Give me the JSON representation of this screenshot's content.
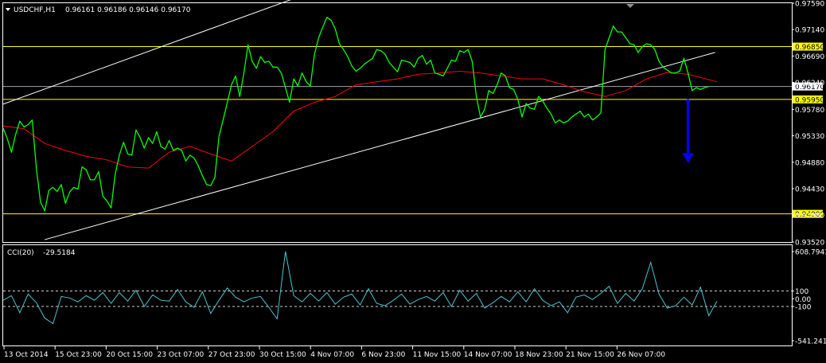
{
  "chart_data": [
    {
      "type": "line",
      "instrument": "USDCHF,H1",
      "header_values": "0.96161 0.96186 0.96146 0.96170",
      "ylim": [
        0.9352,
        0.9759
      ],
      "y_ticks": [
        "0.97590",
        "0.97140",
        "0.96690",
        "0.96240",
        "0.95780",
        "0.95330",
        "0.94880",
        "0.94430",
        "0.93980",
        "0.93520"
      ],
      "x_ticks": [
        "13 Oct 2014",
        "15 Oct 23:00",
        "20 Oct 15:00",
        "23 Oct 07:00",
        "27 Oct 23:00",
        "30 Oct 15:00",
        "4 Nov 07:00",
        "6 Nov 23:00",
        "11 Nov 15:00",
        "14 Nov 07:00",
        "18 Nov 23:00",
        "21 Nov 15:00",
        "26 Nov 07:00"
      ],
      "horizontal_levels": [
        {
          "value": 0.9685,
          "label": "0.96850",
          "color": "#ffff00"
        },
        {
          "value": 0.9595,
          "label": "0.95950",
          "color": "#ffff00"
        },
        {
          "value": 0.94,
          "label": "0.94000",
          "color": "#ffff00"
        },
        {
          "value": 0.9617,
          "label": "0.96170",
          "color": "#9aa3b5",
          "kind": "bid"
        }
      ],
      "channel_lines": [
        {
          "color": "#ffffff",
          "points": [
            [
              0,
              0.9587
            ],
            [
              176,
              0.9813
            ]
          ]
        },
        {
          "color": "#ffffff",
          "points": [
            [
              20,
              0.9356
            ],
            [
              343,
              0.9675
            ]
          ]
        }
      ],
      "price_series": {
        "name": "price",
        "color": "#00ff00",
        "x": [
          0,
          2,
          4,
          6,
          8,
          10,
          12,
          14,
          16,
          18,
          20,
          22,
          24,
          26,
          28,
          30,
          32,
          34,
          36,
          38,
          40,
          42,
          44,
          46,
          48,
          50,
          52,
          54,
          56,
          58,
          60,
          62,
          64,
          66,
          68,
          70,
          72,
          74,
          76,
          78,
          80,
          82,
          84,
          86,
          88,
          90,
          92,
          94,
          96,
          98,
          100,
          102,
          104,
          106,
          108,
          110,
          112,
          114,
          116,
          118,
          120,
          122,
          124,
          126,
          128,
          130,
          132,
          134,
          136,
          138,
          140,
          142,
          144,
          146,
          148,
          150,
          152,
          154,
          156,
          158,
          160,
          162,
          164,
          166,
          168,
          170,
          172,
          174,
          176,
          178,
          180,
          182,
          184,
          186,
          188,
          190,
          192,
          194,
          196,
          198,
          200,
          202,
          204,
          206,
          208,
          210,
          212,
          214,
          216,
          218,
          220,
          222,
          224,
          226,
          228,
          230,
          232,
          234,
          236,
          238,
          240,
          242,
          244,
          246,
          248,
          250,
          252,
          254,
          256,
          258,
          260,
          262,
          264,
          266,
          268,
          270,
          272,
          274,
          276,
          278,
          280,
          282,
          284,
          286,
          288,
          290,
          292,
          294,
          296,
          298,
          300,
          302,
          304,
          306,
          308,
          310,
          312,
          314,
          316,
          318,
          320,
          322,
          324,
          326,
          328,
          330,
          332,
          334,
          336,
          338,
          340,
          342,
          344
        ],
        "values": [
          0.9546,
          0.9528,
          0.9505,
          0.9535,
          0.9558,
          0.9548,
          0.9552,
          0.956,
          0.9478,
          0.942,
          0.9405,
          0.944,
          0.9445,
          0.9438,
          0.945,
          0.9418,
          0.9437,
          0.9445,
          0.9442,
          0.948,
          0.9475,
          0.9458,
          0.9458,
          0.9472,
          0.943,
          0.9422,
          0.941,
          0.9468,
          0.95,
          0.9522,
          0.9502,
          0.95,
          0.9543,
          0.953,
          0.9512,
          0.953,
          0.952,
          0.954,
          0.9515,
          0.951,
          0.9525,
          0.9508,
          0.9512,
          0.9508,
          0.949,
          0.95,
          0.9495,
          0.9482,
          0.9465,
          0.945,
          0.9448,
          0.9462,
          0.9532,
          0.956,
          0.959,
          0.962,
          0.9635,
          0.96,
          0.964,
          0.9688,
          0.966,
          0.9648,
          0.9668,
          0.9658,
          0.966,
          0.965,
          0.965,
          0.964,
          0.9615,
          0.959,
          0.963,
          0.9618,
          0.964,
          0.9625,
          0.9618,
          0.9672,
          0.97,
          0.9718,
          0.9735,
          0.973,
          0.9715,
          0.969,
          0.968,
          0.9668,
          0.9652,
          0.9643,
          0.9648,
          0.9655,
          0.966,
          0.9665,
          0.968,
          0.9678,
          0.9672,
          0.9658,
          0.965,
          0.9642,
          0.9662,
          0.966,
          0.9658,
          0.965,
          0.9665,
          0.967,
          0.9655,
          0.9662,
          0.964,
          0.9638,
          0.9635,
          0.9648,
          0.9662,
          0.966,
          0.9678,
          0.9675,
          0.968,
          0.966,
          0.96,
          0.9565,
          0.9578,
          0.961,
          0.9605,
          0.962,
          0.964,
          0.9635,
          0.9615,
          0.9612,
          0.9595,
          0.9565,
          0.9588,
          0.958,
          0.9578,
          0.96,
          0.9592,
          0.958,
          0.957,
          0.9555,
          0.956,
          0.9555,
          0.9558,
          0.9565,
          0.957,
          0.9575,
          0.9565,
          0.957,
          0.956,
          0.9565,
          0.9572,
          0.968,
          0.97,
          0.972,
          0.971,
          0.971,
          0.97,
          0.969,
          0.9688,
          0.9675,
          0.9685,
          0.969,
          0.9688,
          0.968,
          0.966,
          0.965,
          0.9645,
          0.964,
          0.964,
          0.9643,
          0.9665,
          0.964,
          0.961,
          0.9615,
          0.9612,
          0.9615,
          0.9617
        ]
      },
      "moving_average": {
        "color": "#ff0000",
        "x": [
          0,
          10,
          20,
          30,
          40,
          50,
          60,
          70,
          80,
          90,
          100,
          110,
          120,
          130,
          140,
          150,
          160,
          170,
          180,
          190,
          200,
          210,
          220,
          230,
          240,
          250,
          260,
          270,
          280,
          290,
          300,
          310,
          320,
          330,
          344
        ],
        "values": [
          0.955,
          0.9545,
          0.952,
          0.9508,
          0.9498,
          0.9492,
          0.948,
          0.9478,
          0.9505,
          0.9515,
          0.9502,
          0.949,
          0.9515,
          0.954,
          0.9575,
          0.959,
          0.96,
          0.962,
          0.9625,
          0.963,
          0.9638,
          0.964,
          0.9643,
          0.964,
          0.9635,
          0.963,
          0.963,
          0.962,
          0.9608,
          0.96,
          0.961,
          0.963,
          0.9641,
          0.9638,
          0.9625
        ]
      },
      "annotation_arrow": {
        "color": "#0000ff",
        "from": [
          330,
          0.9592
        ],
        "to": [
          330,
          0.9487
        ],
        "direction": "down"
      }
    },
    {
      "type": "line",
      "indicator": "CCI(20)",
      "header_value": "-29.5184",
      "ylim": [
        -541.2411,
        608.7943
      ],
      "y_ticks": [
        "608.7943",
        "100",
        "0.00",
        "-100",
        "-541.2411"
      ],
      "reference_levels": [
        100,
        -100
      ],
      "series": [
        {
          "name": "CCI",
          "color": "#52c2d0",
          "x": [
            0,
            4,
            8,
            12,
            16,
            20,
            24,
            28,
            32,
            36,
            40,
            44,
            48,
            52,
            56,
            60,
            64,
            68,
            72,
            76,
            80,
            84,
            88,
            92,
            96,
            100,
            104,
            108,
            112,
            116,
            120,
            124,
            128,
            132,
            136,
            140,
            144,
            148,
            152,
            156,
            160,
            164,
            168,
            172,
            176,
            180,
            184,
            188,
            192,
            196,
            200,
            204,
            208,
            212,
            216,
            220,
            224,
            228,
            232,
            236,
            240,
            244,
            248,
            252,
            256,
            260,
            264,
            268,
            272,
            276,
            280,
            284,
            288,
            292,
            296,
            300,
            304,
            308,
            312,
            316,
            320,
            324,
            328,
            332,
            336,
            340,
            344
          ],
          "values": [
            -20,
            40,
            -180,
            60,
            -50,
            -250,
            -320,
            30,
            10,
            -40,
            40,
            -20,
            80,
            -60,
            80,
            -30,
            110,
            -100,
            50,
            -20,
            -30,
            120,
            -40,
            -110,
            90,
            -190,
            -20,
            140,
            20,
            -40,
            10,
            30,
            -110,
            -260,
            610,
            40,
            -40,
            70,
            -30,
            80,
            -70,
            20,
            60,
            -80,
            130,
            -60,
            -90,
            -20,
            60,
            -70,
            -10,
            30,
            -30,
            80,
            -100,
            110,
            -30,
            70,
            -120,
            -50,
            30,
            -40,
            90,
            -40,
            130,
            -20,
            -90,
            -40,
            -180,
            20,
            50,
            -10,
            70,
            160,
            -60,
            70,
            -30,
            130,
            470,
            60,
            -120,
            -90,
            20,
            -80,
            150,
            -220,
            -30
          ]
        }
      ]
    }
  ]
}
